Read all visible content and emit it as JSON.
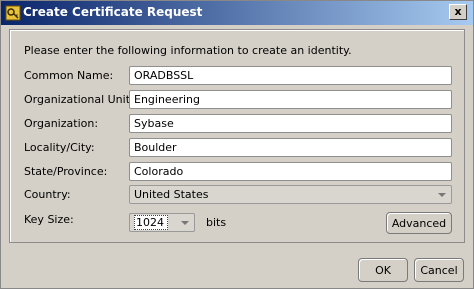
{
  "window": {
    "title": "Create Certificate Request",
    "close_label": "x"
  },
  "form": {
    "intro": "Please enter the following information to create an identity.",
    "fields": [
      {
        "label": "Common Name:",
        "value": "ORADBSSL"
      },
      {
        "label": "Organizational Unit:",
        "value": "Engineering"
      },
      {
        "label": "Organization:",
        "value": "Sybase"
      },
      {
        "label": "Locality/City:",
        "value": "Boulder"
      },
      {
        "label": "State/Province:",
        "value": "Colorado"
      }
    ],
    "country": {
      "label": "Country:",
      "value": "United States"
    },
    "key_size": {
      "label": "Key Size:",
      "value": "1024",
      "unit": "bits"
    },
    "advanced_label": "Advanced"
  },
  "buttons": {
    "ok": "OK",
    "cancel": "Cancel"
  },
  "colors": {
    "titlebar_start": "#0a246a",
    "titlebar_end": "#a6caf0",
    "face": "#d4d0c8"
  }
}
